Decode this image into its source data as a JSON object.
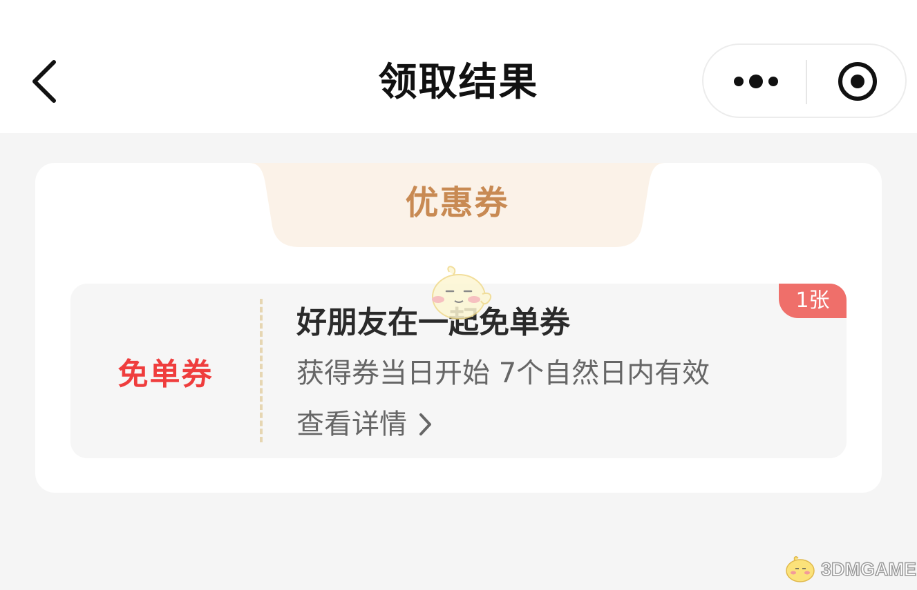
{
  "header": {
    "back_icon": "chevron-left-icon",
    "title": "领取结果",
    "capsule": {
      "more_icon": "more-dots-icon",
      "close_icon": "target-circle-icon"
    }
  },
  "card": {
    "tab_label": "优惠券",
    "coupon": {
      "type_label": "免单券",
      "name": "好朋友在一起免单券",
      "validity": "获得券当日开始 7个自然日内有效",
      "detail_link": "查看详情",
      "detail_icon": "chevron-right-icon",
      "quantity_badge": "1张"
    }
  },
  "watermark": {
    "text": "3DMGAME"
  },
  "colors": {
    "page_background": "#f5f5f5",
    "tab_text": "#c88a53",
    "tab_background": "#fbf2e8",
    "coupon_type_text": "#ef3d3d",
    "badge_background": "#ef6f6a",
    "divider_dashes": "#e6d6b2"
  }
}
